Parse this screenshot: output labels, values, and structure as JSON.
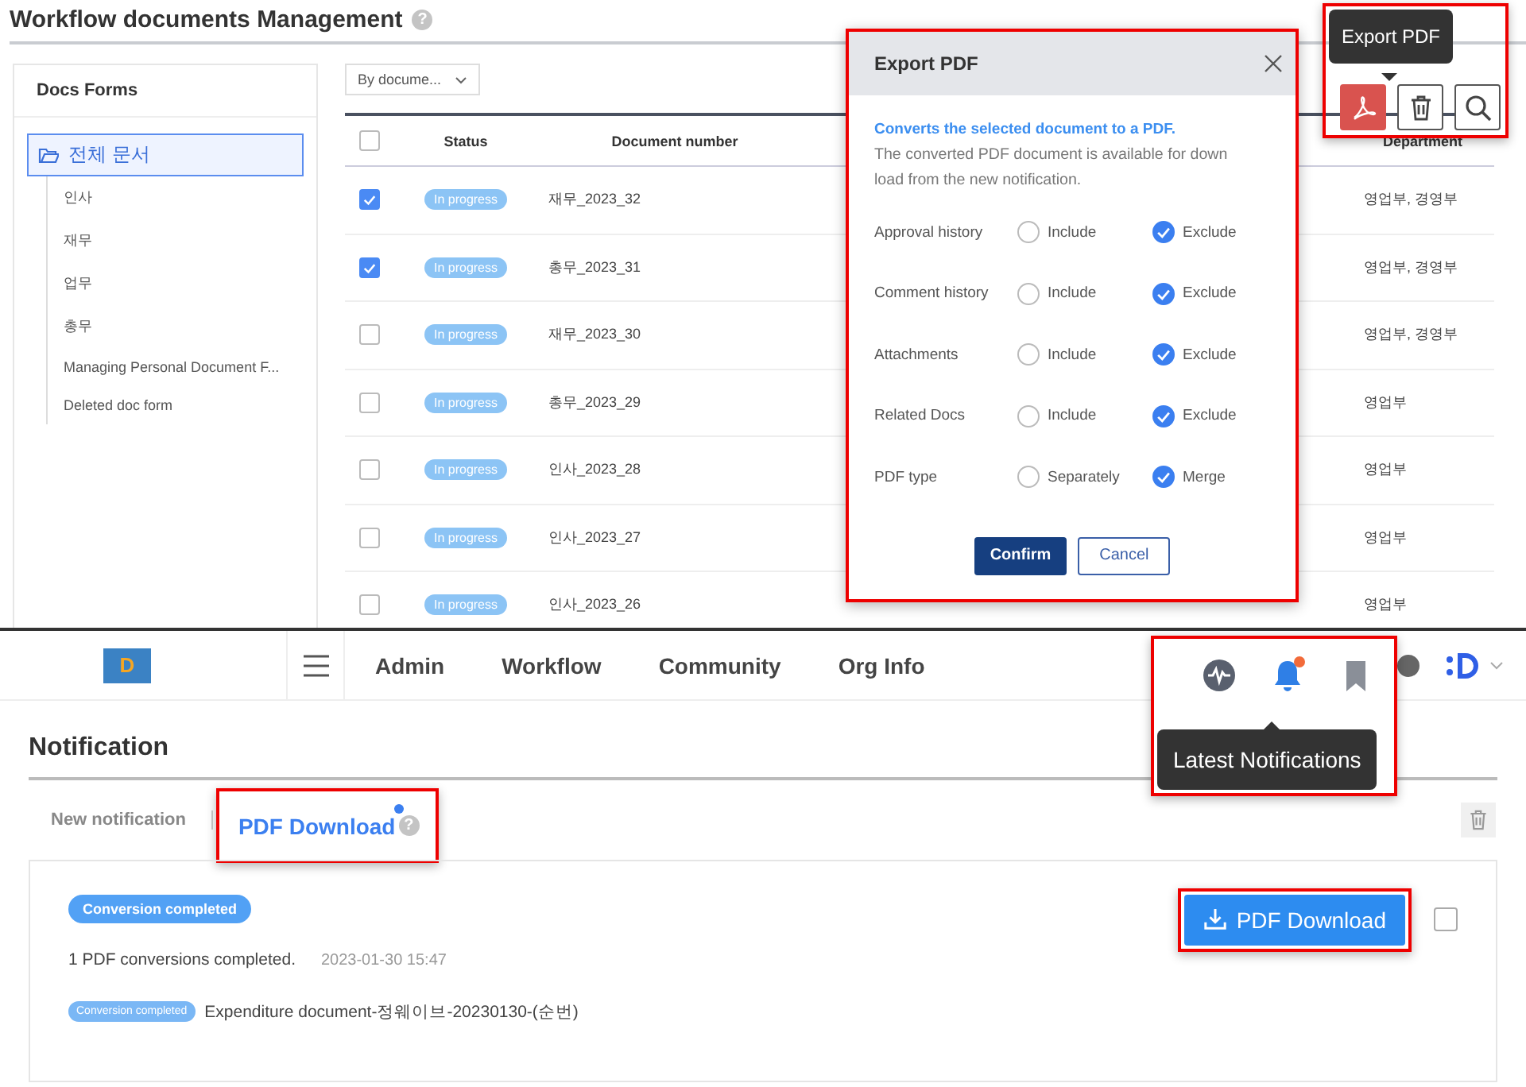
{
  "page_title": "Workflow documents Management",
  "title_help": "?",
  "sidebar": {
    "title": "Docs Forms",
    "tree": [
      {
        "label": "전체 문서",
        "selected": true,
        "children": [
          {
            "label": "인사",
            "selected": false
          },
          {
            "label": "재무",
            "selected": false
          },
          {
            "label": "업무",
            "selected": false
          },
          {
            "label": "총무",
            "selected": false
          },
          {
            "label": "Managing Personal Document F...",
            "selected": false
          },
          {
            "label": "Deleted doc form",
            "selected": false
          }
        ]
      }
    ]
  },
  "filter_dropdown": {
    "value": "By docume..."
  },
  "table": {
    "columns": [
      "Status",
      "Document number",
      "Department"
    ],
    "header_checked": false,
    "rows": [
      {
        "checked": true,
        "status": "In progress",
        "document_number": "재무_2023_32",
        "department": "영업부, 경영부"
      },
      {
        "checked": true,
        "status": "In progress",
        "document_number": "총무_2023_31",
        "department": "영업부, 경영부"
      },
      {
        "checked": false,
        "status": "In progress",
        "document_number": "재무_2023_30",
        "department": "영업부, 경영부"
      },
      {
        "checked": false,
        "status": "In progress",
        "document_number": "총무_2023_29",
        "department": "영업부"
      },
      {
        "checked": false,
        "status": "In progress",
        "document_number": "인사_2023_28",
        "department": "영업부"
      },
      {
        "checked": false,
        "status": "In progress",
        "document_number": "인사_2023_27",
        "department": "영업부"
      },
      {
        "checked": false,
        "status": "In progress",
        "document_number": "인사_2023_26",
        "department": "영업부"
      }
    ]
  },
  "toolbar": {
    "tooltip": "Export PDF",
    "buttons": [
      {
        "kind": "pdf",
        "selected": true
      },
      {
        "kind": "trash",
        "selected": false
      },
      {
        "kind": "search",
        "selected": false
      }
    ]
  },
  "export_dialog": {
    "title": "Export PDF",
    "lead": "Converts the selected document to a PDF.",
    "description": "The converted PDF document is available for down load from the new notification.",
    "options": [
      {
        "label": "Approval history",
        "choices": [
          {
            "label": "Include",
            "selected": false
          },
          {
            "label": "Exclude",
            "selected": true
          }
        ]
      },
      {
        "label": "Comment history",
        "choices": [
          {
            "label": "Include",
            "selected": false
          },
          {
            "label": "Exclude",
            "selected": true
          }
        ]
      },
      {
        "label": "Attachments",
        "choices": [
          {
            "label": "Include",
            "selected": false
          },
          {
            "label": "Exclude",
            "selected": true
          }
        ]
      },
      {
        "label": "Related Docs",
        "choices": [
          {
            "label": "Include",
            "selected": false
          },
          {
            "label": "Exclude",
            "selected": true
          }
        ]
      },
      {
        "label": "PDF type",
        "choices": [
          {
            "label": "Separately",
            "selected": false
          },
          {
            "label": "Merge",
            "selected": true
          }
        ]
      }
    ],
    "buttons": [
      {
        "label": "Confirm",
        "kind": "primary"
      },
      {
        "label": "Cancel",
        "kind": "secondary"
      }
    ]
  },
  "nav": {
    "logo_text": "D",
    "menu": [
      "Admin",
      "Workflow",
      "Community",
      "Org Info"
    ],
    "tooltip": "Latest Notifications",
    "icons": [
      {
        "kind": "wave",
        "unread": false
      },
      {
        "kind": "bell",
        "unread": true
      },
      {
        "kind": "bookmark",
        "unread": false
      }
    ]
  },
  "notification": {
    "title": "Notification",
    "tabs": [
      {
        "label": "New notification",
        "selected": false,
        "new": false
      },
      {
        "label": "PDF Download",
        "selected": true,
        "new": true,
        "help": "?"
      }
    ],
    "item": {
      "badge": "Conversion completed",
      "message": "1 PDF conversions completed.",
      "time": "2023-01-30 15:47",
      "download_label": "PDF Download",
      "checked": false,
      "files": [
        {
          "badge": "Conversion completed",
          "name": "Expenditure document-정웨이브-20230130-(순번)"
        }
      ]
    }
  }
}
